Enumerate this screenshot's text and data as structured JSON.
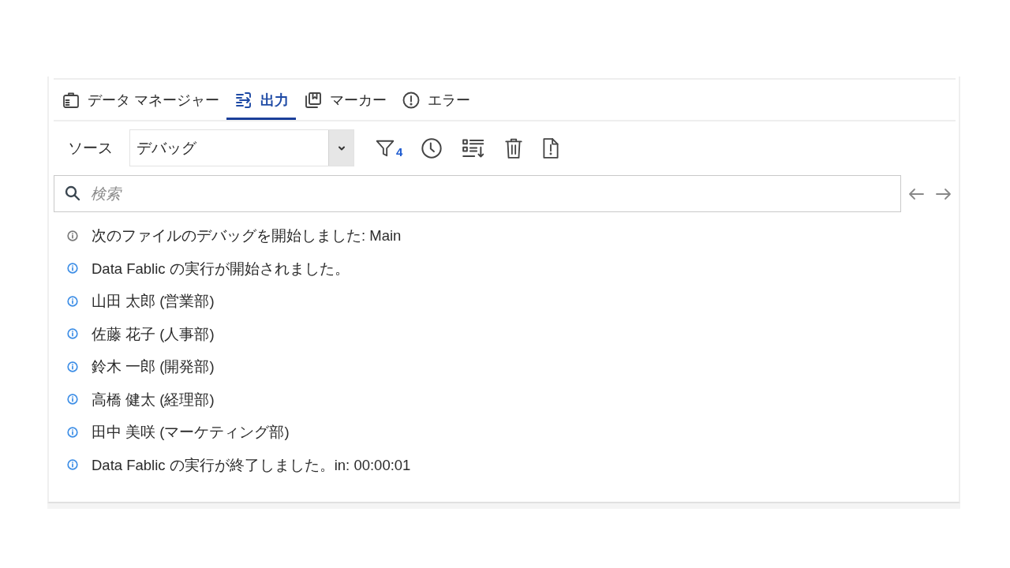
{
  "tabs": [
    {
      "label": "データ マネージャー",
      "selected": false
    },
    {
      "label": "出力",
      "selected": true
    },
    {
      "label": "マーカー",
      "selected": false
    },
    {
      "label": "エラー",
      "selected": false
    }
  ],
  "toolbar": {
    "source_label": "ソース",
    "source_value": "デバッグ",
    "filter_count": "4"
  },
  "search": {
    "placeholder": "検索"
  },
  "log": [
    {
      "kind": "debug",
      "text": "次のファイルのデバッグを開始しました: Main"
    },
    {
      "kind": "info",
      "text": "Data Fablic の実行が開始されました。"
    },
    {
      "kind": "info",
      "text": "山田 太郎 (営業部)"
    },
    {
      "kind": "info",
      "text": "佐藤 花子 (人事部)"
    },
    {
      "kind": "info",
      "text": "鈴木 一郎 (開発部)"
    },
    {
      "kind": "info",
      "text": "高橋 健太 (経理部)"
    },
    {
      "kind": "info",
      "text": "田中 美咲 (マーケティング部)"
    },
    {
      "kind": "info",
      "text": "Data Fablic の実行が終了しました。in: 00:00:01"
    }
  ]
}
